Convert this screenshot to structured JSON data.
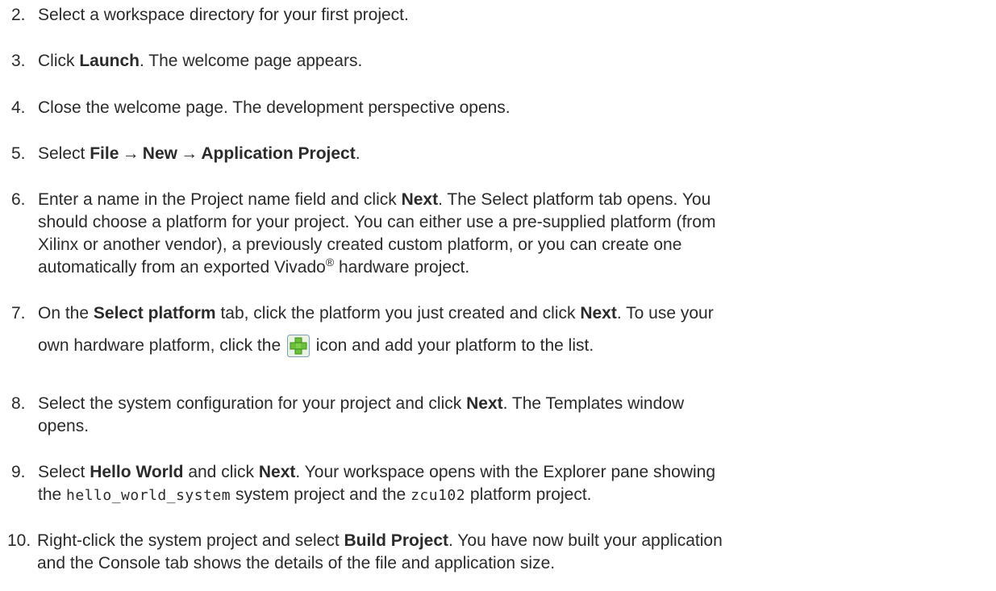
{
  "steps": [
    {
      "num": "2.",
      "text": "Select a workspace directory for your first project."
    },
    {
      "num": "3.",
      "a": "Click ",
      "b1": "Launch",
      "c": ". The welcome page appears."
    },
    {
      "num": "4.",
      "text": "Close the welcome page. The development perspective opens."
    },
    {
      "num": "5.",
      "a": "Select ",
      "b1": "File → New → Application Project",
      "c": "."
    },
    {
      "num": "6.",
      "l1a": "Enter a name in the Project name field and click ",
      "l1b": "Next",
      "l1c": ". The Select platform tab opens. You",
      "l2": "should choose a platform for your project. You can either use a pre-supplied platform (from",
      "l3": "Xilinx or another vendor), a previously created custom platform, or you can create one",
      "l4a": "automatically from an exported Vivado",
      "l4sup": "®",
      "l4b": " hardware project."
    },
    {
      "num": "7.",
      "l1a": "On the ",
      "l1b": "Select platform",
      "l1c": " tab, click the platform you just created and click ",
      "l1d": "Next",
      "l1e": ". To use your",
      "l2a": "own hardware platform, click the ",
      "l2b": " icon and add your platform to the list."
    },
    {
      "num": "8.",
      "l1a": "Select the system configuration for your project and click ",
      "l1b": "Next",
      "l1c": ". The Templates window",
      "l2": "opens."
    },
    {
      "num": "9.",
      "l1a": "Select ",
      "l1b": "Hello World",
      "l1c": " and click ",
      "l1d": "Next",
      "l1e": ". Your workspace opens with the Explorer pane showing",
      "l2a": "the ",
      "l2code1": "hello_world_system",
      "l2b": " system project and the ",
      "l2code2": "zcu102",
      "l2c": " platform project."
    },
    {
      "num": "10.",
      "l1a": "Right-click the system project and select ",
      "l1b": "Build Project",
      "l1c": ". You have now built your application",
      "l2": "and the Console tab shows the details of the file and application size."
    }
  ],
  "icon": {
    "name": "add-platform-icon",
    "color_bg": "#e9f2e3",
    "color_cross": "#6cbf3a",
    "color_border": "#7e9fb8"
  }
}
